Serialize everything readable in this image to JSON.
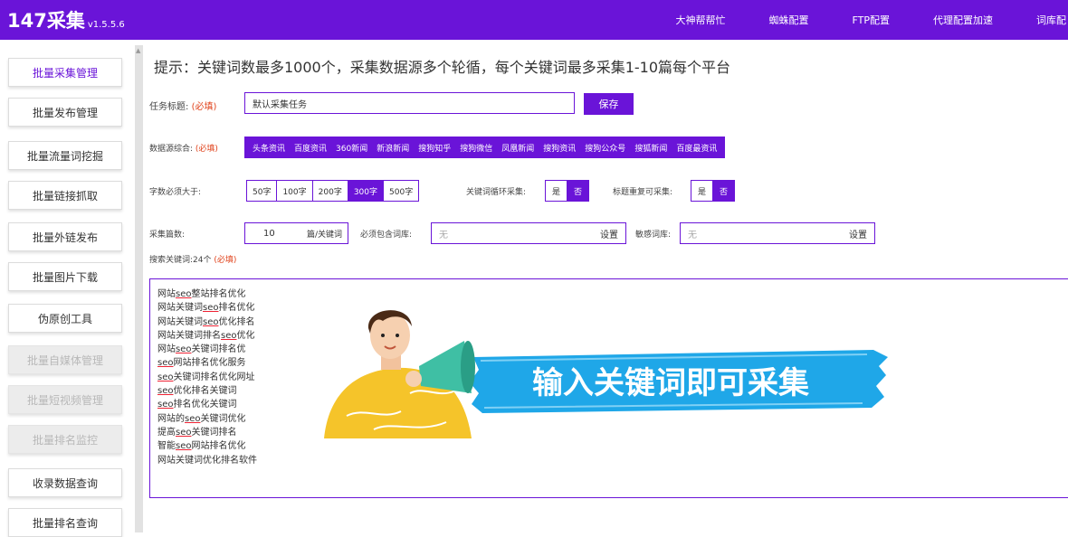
{
  "header": {
    "brand": "147采集",
    "version": "v1.5.5.6",
    "nav": [
      "大神帮帮忙",
      "蜘蛛配置",
      "FTP配置",
      "代理配置加速",
      "词库配"
    ]
  },
  "sidebar": {
    "items": [
      {
        "label": "批量采集管理",
        "state": "active"
      },
      {
        "label": "批量发布管理",
        "state": "normal"
      },
      {
        "label": "批量流量词挖掘",
        "state": "normal"
      },
      {
        "label": "批量链接抓取",
        "state": "normal"
      },
      {
        "label": "批量外链发布",
        "state": "normal"
      },
      {
        "label": "批量图片下载",
        "state": "normal"
      },
      {
        "label": "伪原创工具",
        "state": "normal"
      },
      {
        "label": "批量自媒体管理",
        "state": "disabled"
      },
      {
        "label": "批量短视频管理",
        "state": "disabled"
      },
      {
        "label": "批量排名监控",
        "state": "disabled"
      },
      {
        "label": "收录数据查询",
        "state": "normal"
      },
      {
        "label": "批量排名查询",
        "state": "normal"
      }
    ]
  },
  "main": {
    "hint": "提示：关键词数最多1000个，采集数据源多个轮循，每个关键词最多采集1-10篇每个平台",
    "task": {
      "label": "任务标题:",
      "required": "(必填)",
      "value": "默认采集任务",
      "save": "保存"
    },
    "sources": {
      "label": "数据源综合:",
      "required": "(必填)",
      "items": [
        "头条资讯",
        "百度资讯",
        "360新闻",
        "新浪新闻",
        "搜狗知乎",
        "搜狗微信",
        "凤凰新闻",
        "搜狗资讯",
        "搜狗公众号",
        "搜狐新闻",
        "百度最资讯"
      ]
    },
    "wordcount": {
      "label": "字数必须大于:",
      "options": [
        "50字",
        "100字",
        "200字",
        "300字",
        "500字"
      ],
      "selected": "300字"
    },
    "keyword_loop": {
      "label": "关键词循环采集:",
      "options": [
        "是",
        "否"
      ],
      "selected": "否"
    },
    "title_repeat": {
      "label": "标题重复可采集:",
      "options": [
        "是",
        "否"
      ],
      "selected": "否"
    },
    "count": {
      "label": "采集篇数:",
      "value": "10",
      "unit": "篇/关键词"
    },
    "must_include": {
      "label": "必须包含词库:",
      "placeholder": "无",
      "set": "设置"
    },
    "sensitive": {
      "label": "敏感词库:",
      "placeholder": "无",
      "set": "设置"
    },
    "keywords": {
      "label": "搜索关键词:24个",
      "required": "(必填)",
      "list": [
        "网站seo整站排名优化",
        "网站关键词seo排名优化",
        "网站关键词seo优化排名",
        "网站关键词排名seo优化",
        "网站seo关键词排名优",
        "seo网站排名优化服务",
        "seo关键词排名优化网址",
        "seo优化排名关键词",
        "seo排名优化关键词",
        "网站的seo关键词优化",
        "提高seo关键词排名",
        "智能seo网站排名优化",
        "网站关键词优化排名软件"
      ]
    },
    "banner": {
      "text": "输入关键词即可采集"
    }
  }
}
